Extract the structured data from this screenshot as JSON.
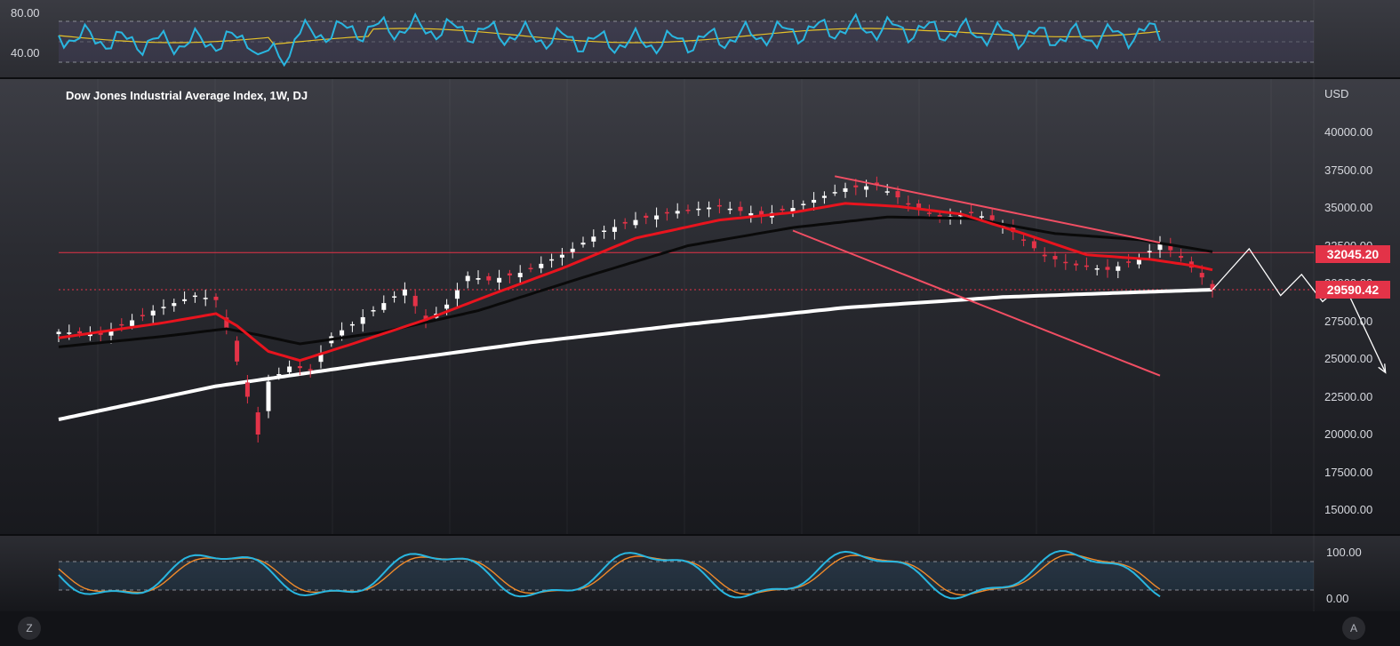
{
  "chart_title": "Dow Jones Industrial Average Index, 1W, DJ",
  "currency": "USD",
  "rsi_pane": {
    "ticks": [
      "80.00",
      "40.00"
    ]
  },
  "stoch_pane": {
    "ticks": [
      "100.00",
      "0.00"
    ]
  },
  "price_badges": {
    "resistance": "32045.20",
    "support": "29590.42"
  },
  "footer": {
    "left_button": "Z",
    "right_button": "A"
  },
  "colors": {
    "bullish_candle": "#ffffff",
    "bearish_candle": "#e33348",
    "ema_fast": "#e8141e",
    "sma_mid": "#0a0a0a",
    "sma_long": "#ffffff",
    "channel": "#f04e63",
    "rsi": "#29b6e0",
    "rsi_signal": "#e6c229",
    "stoch_k": "#29b6e0",
    "stoch_d": "#f08a2a"
  },
  "chart_data": {
    "type": "candlestick",
    "title": "Dow Jones Industrial Average Index, 1W, DJ",
    "ylabel": "USD",
    "ylim": [
      15000,
      42000
    ],
    "y_ticks": [
      "40000.00",
      "37500.00",
      "35000.00",
      "32500.00",
      "30000.00",
      "27500.00",
      "25000.00",
      "22500.00",
      "20000.00",
      "17500.00",
      "15000.00"
    ],
    "horizontal_levels": [
      {
        "label": "32045.20",
        "value": 32045.2,
        "style": "solid"
      },
      {
        "label": "29590.42",
        "value": 29590.42,
        "style": "dotted"
      }
    ],
    "close_series_anchors": [
      [
        0,
        26800
      ],
      [
        8,
        26600
      ],
      [
        18,
        28200
      ],
      [
        26,
        29200
      ],
      [
        30,
        28900
      ],
      [
        33,
        26000
      ],
      [
        36,
        22500
      ],
      [
        38,
        20000
      ],
      [
        40,
        23500
      ],
      [
        44,
        24500
      ],
      [
        48,
        24300
      ],
      [
        52,
        26500
      ],
      [
        56,
        27300
      ],
      [
        62,
        28700
      ],
      [
        66,
        29600
      ],
      [
        70,
        27400
      ],
      [
        74,
        28600
      ],
      [
        78,
        30500
      ],
      [
        82,
        30200
      ],
      [
        88,
        30700
      ],
      [
        96,
        31900
      ],
      [
        104,
        33500
      ],
      [
        110,
        34200
      ],
      [
        118,
        34800
      ],
      [
        126,
        35100
      ],
      [
        134,
        34500
      ],
      [
        140,
        35000
      ],
      [
        146,
        35800
      ],
      [
        150,
        36300
      ],
      [
        156,
        36500
      ],
      [
        162,
        35300
      ],
      [
        168,
        34300
      ],
      [
        174,
        34700
      ],
      [
        178,
        34200
      ],
      [
        182,
        33400
      ],
      [
        188,
        31800
      ],
      [
        194,
        31200
      ],
      [
        200,
        30900
      ],
      [
        206,
        31600
      ],
      [
        210,
        32700
      ],
      [
        214,
        31700
      ],
      [
        218,
        30400
      ],
      [
        220,
        29590
      ]
    ],
    "ema_fast_anchors": [
      [
        0,
        26400
      ],
      [
        20,
        27400
      ],
      [
        30,
        28000
      ],
      [
        34,
        27200
      ],
      [
        40,
        25500
      ],
      [
        46,
        24900
      ],
      [
        56,
        26000
      ],
      [
        70,
        27600
      ],
      [
        82,
        29200
      ],
      [
        96,
        31000
      ],
      [
        110,
        33000
      ],
      [
        126,
        34200
      ],
      [
        140,
        34700
      ],
      [
        150,
        35300
      ],
      [
        160,
        35100
      ],
      [
        172,
        34600
      ],
      [
        184,
        33300
      ],
      [
        196,
        31900
      ],
      [
        208,
        31600
      ],
      [
        216,
        31200
      ],
      [
        220,
        30900
      ]
    ],
    "sma_mid_anchors": [
      [
        0,
        25800
      ],
      [
        20,
        26500
      ],
      [
        32,
        27000
      ],
      [
        38,
        26600
      ],
      [
        46,
        26000
      ],
      [
        62,
        26800
      ],
      [
        80,
        28200
      ],
      [
        100,
        30400
      ],
      [
        120,
        32500
      ],
      [
        140,
        33700
      ],
      [
        158,
        34400
      ],
      [
        174,
        34300
      ],
      [
        190,
        33300
      ],
      [
        206,
        32900
      ],
      [
        220,
        32100
      ]
    ],
    "sma_long_anchors": [
      [
        0,
        21000
      ],
      [
        30,
        23200
      ],
      [
        60,
        24700
      ],
      [
        90,
        26100
      ],
      [
        120,
        27300
      ],
      [
        150,
        28400
      ],
      [
        180,
        29100
      ],
      [
        200,
        29350
      ],
      [
        220,
        29590
      ]
    ],
    "channel": {
      "upper": {
        "from": [
          148,
          37100
        ],
        "to": [
          210,
          32700
        ]
      },
      "lower": {
        "from": [
          140,
          33500
        ],
        "to": [
          210,
          23900
        ]
      }
    },
    "projection_path": [
      [
        220,
        29590
      ],
      [
        227,
        32300
      ],
      [
        233,
        29200
      ],
      [
        237,
        30600
      ],
      [
        241,
        28800
      ],
      [
        245,
        30000
      ],
      [
        253,
        24100
      ]
    ]
  }
}
